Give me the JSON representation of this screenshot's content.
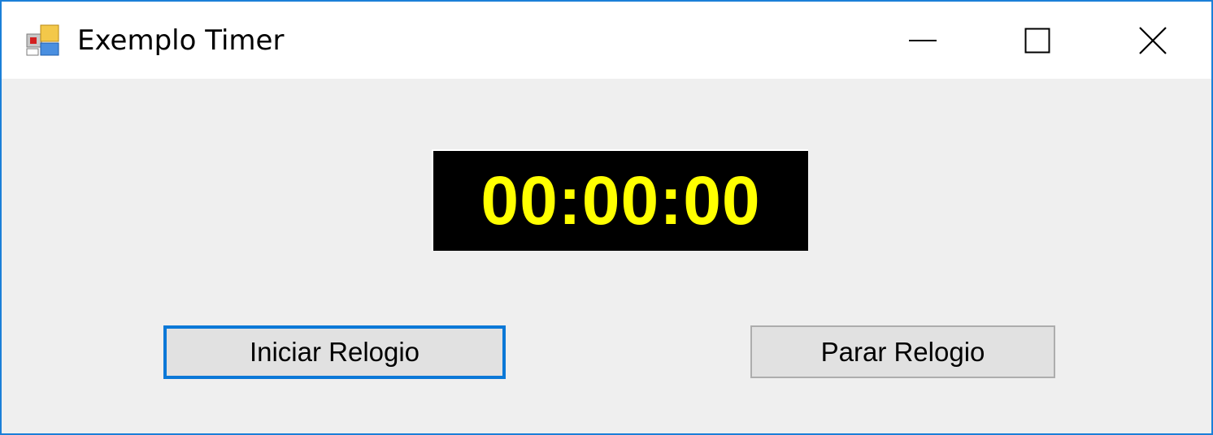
{
  "window": {
    "title": "Exemplo Timer",
    "app_icon": "winforms-app-icon",
    "controls": {
      "minimize_icon": "minimize-icon",
      "maximize_icon": "maximize-icon",
      "close_icon": "close-icon"
    },
    "accent_color": "#1b7fd8"
  },
  "clock": {
    "value": "00:00:00",
    "background_color": "#000000",
    "text_color": "#ffff00"
  },
  "buttons": {
    "start_label": "Iniciar Relogio",
    "stop_label": "Parar Relogio"
  }
}
